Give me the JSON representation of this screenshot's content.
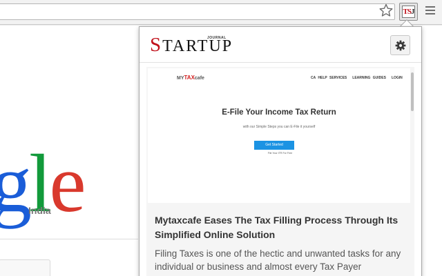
{
  "browser": {
    "extension_logo": {
      "t": "T",
      "s": "S",
      "j": "J"
    }
  },
  "page": {
    "logo_letters": [
      "g",
      "l",
      "e"
    ],
    "region": "India"
  },
  "popup": {
    "brand": {
      "first": "S",
      "rest": "TARTUP",
      "tag": "JOURNAL"
    },
    "preview": {
      "logo_prefix": "MY",
      "logo_main": "TAX",
      "logo_suffix": "cafe",
      "nav": [
        "CA HELP SERVICES",
        "LEARNING GUIDES",
        "LOGIN"
      ],
      "title": "E-File Your Income Tax Return",
      "subtitle": "with our Simple Steps you can E-File it yourself",
      "button": "Get Started",
      "note": "File Your ITR For Free"
    },
    "article": {
      "title": "Mytaxcafe Eases The Tax Filling Process Through Its Simplified Online Solution",
      "body": "Filing Taxes is one of the hectic and unwanted tasks for any individual or business and almost every Tax Payer"
    }
  },
  "colors": {
    "accent_red": "#c1111b",
    "preview_button": "#1c93e3",
    "google_blue": "#1a5dd8",
    "google_green": "#129a3b",
    "google_red": "#d9392d"
  }
}
